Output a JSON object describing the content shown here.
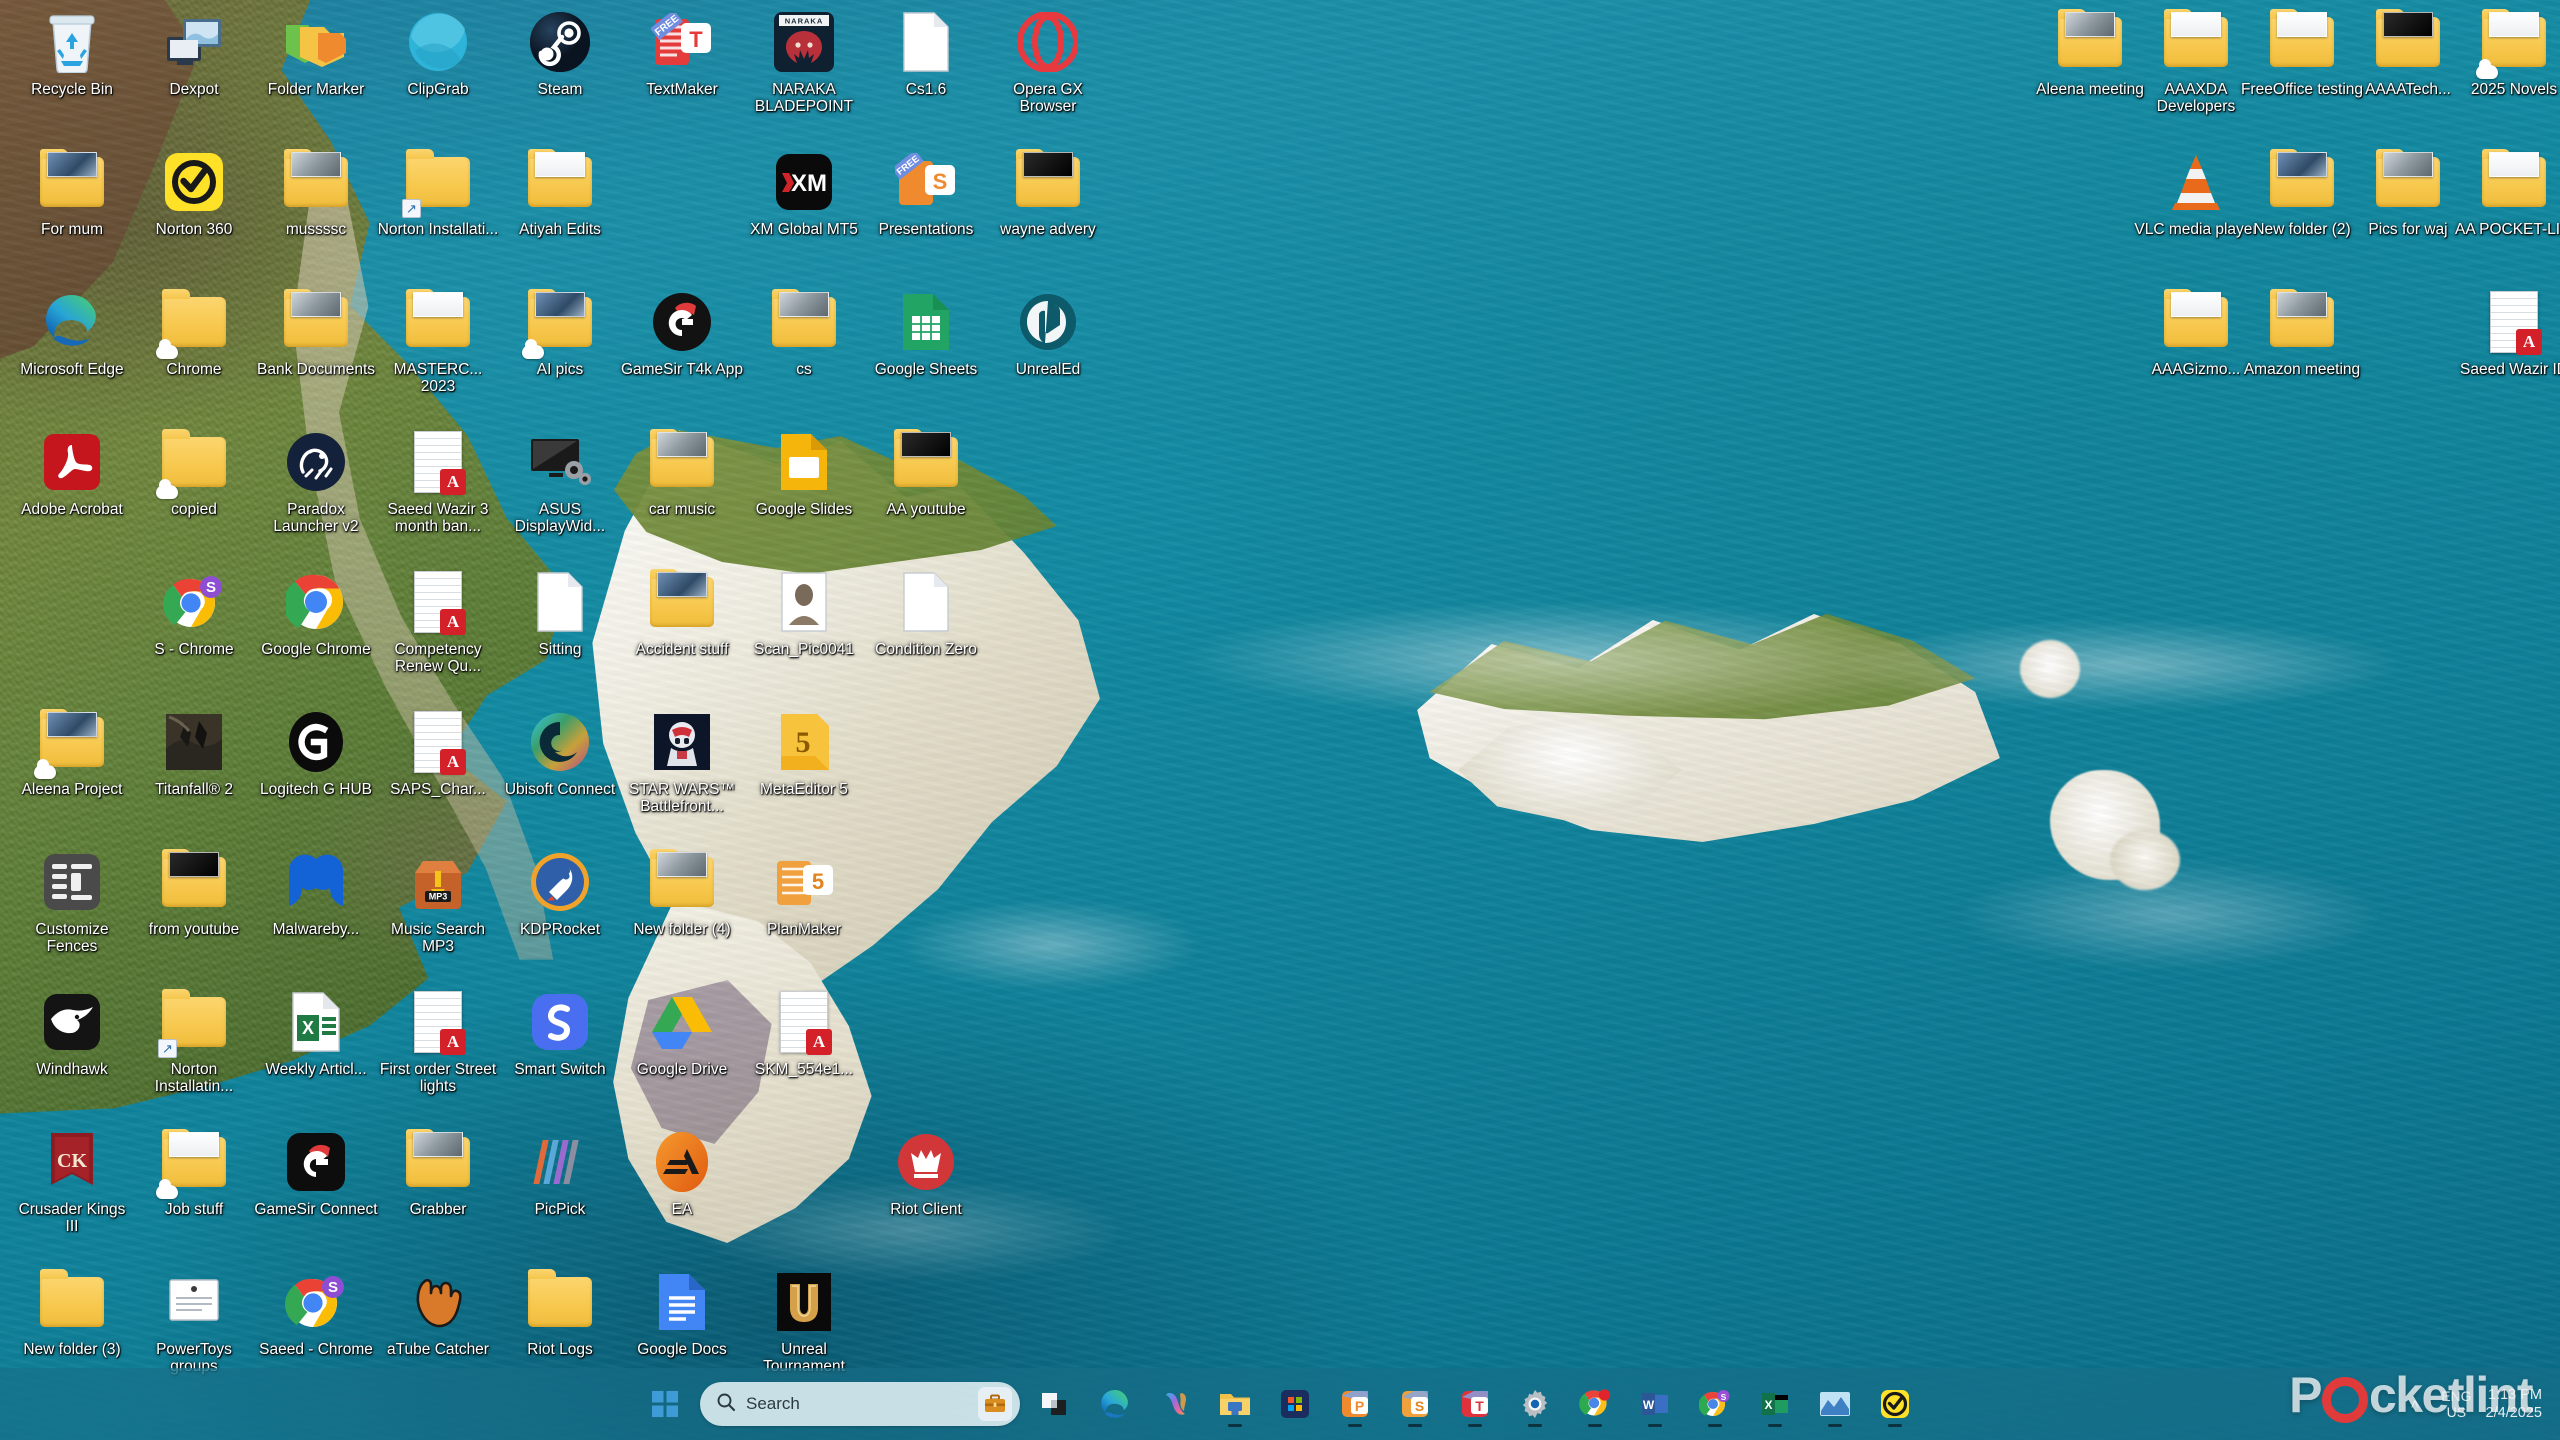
{
  "desktop": {
    "wallpaper_description": "Aerial photo of white chalk cliffs and turquoise sea",
    "left_icons": [
      {
        "label": "Recycle Bin",
        "icon": "recycle-bin-icon",
        "col": 0,
        "row": 0
      },
      {
        "label": "Dexpot",
        "icon": "dexpot-icon",
        "col": 1,
        "row": 0
      },
      {
        "label": "Folder Marker",
        "icon": "folder-marker-icon",
        "col": 2,
        "row": 0
      },
      {
        "label": "ClipGrab",
        "icon": "clipgrab-icon",
        "col": 3,
        "row": 0
      },
      {
        "label": "Steam",
        "icon": "steam-icon",
        "col": 4,
        "row": 0
      },
      {
        "label": "TextMaker",
        "icon": "textmaker-icon",
        "col": 5,
        "row": 0
      },
      {
        "label": "NARAKA BLADEPOINT",
        "icon": "naraka-bladepoint-icon",
        "col": 6,
        "row": 0
      },
      {
        "label": "Cs1.6",
        "icon": "document-icon",
        "col": 7,
        "row": 0
      },
      {
        "label": "Opera GX Browser",
        "icon": "opera-gx-icon",
        "col": 8,
        "row": 0
      },
      {
        "label": "For mum",
        "icon": "folder-icon",
        "col": 0,
        "row": 1
      },
      {
        "label": "Norton 360",
        "icon": "norton-360-icon",
        "col": 1,
        "row": 1
      },
      {
        "label": "mussssc",
        "icon": "folder-icon",
        "col": 2,
        "row": 1
      },
      {
        "label": "Norton Installati...",
        "icon": "folder-shortcut-icon",
        "col": 3,
        "row": 1
      },
      {
        "label": "Atiyah Edits",
        "icon": "folder-icon",
        "col": 4,
        "row": 1
      },
      {
        "label": "XM Global MT5",
        "icon": "xm-global-mt5-icon",
        "col": 6,
        "row": 1
      },
      {
        "label": "Presentations",
        "icon": "presentations-icon",
        "col": 7,
        "row": 1
      },
      {
        "label": "wayne advery",
        "icon": "folder-icon",
        "col": 8,
        "row": 1
      },
      {
        "label": "Microsoft Edge",
        "icon": "microsoft-edge-icon",
        "col": 0,
        "row": 2
      },
      {
        "label": "Chrome",
        "icon": "folder-icon",
        "col": 1,
        "row": 2
      },
      {
        "label": "Bank Documents",
        "icon": "folder-icon",
        "col": 2,
        "row": 2
      },
      {
        "label": "MASTERC... 2023",
        "icon": "folder-icon",
        "col": 3,
        "row": 2
      },
      {
        "label": "AI pics",
        "icon": "folder-icon",
        "col": 4,
        "row": 2
      },
      {
        "label": "GameSir T4k App",
        "icon": "gamesir-icon",
        "col": 5,
        "row": 2
      },
      {
        "label": "cs",
        "icon": "folder-icon",
        "col": 6,
        "row": 2
      },
      {
        "label": "Google Sheets",
        "icon": "google-sheets-icon",
        "col": 7,
        "row": 2
      },
      {
        "label": "UnrealEd",
        "icon": "unreal-engine-icon",
        "col": 8,
        "row": 2
      },
      {
        "label": "Adobe Acrobat",
        "icon": "adobe-acrobat-icon",
        "col": 0,
        "row": 3
      },
      {
        "label": "copied",
        "icon": "folder-icon",
        "col": 1,
        "row": 3
      },
      {
        "label": "Paradox Launcher v2",
        "icon": "paradox-launcher-icon",
        "col": 2,
        "row": 3
      },
      {
        "label": "Saeed Wazir 3 month ban...",
        "icon": "pdf-icon",
        "col": 3,
        "row": 3
      },
      {
        "label": "ASUS DisplayWid...",
        "icon": "asus-displaywidget-icon",
        "col": 4,
        "row": 3
      },
      {
        "label": "car music",
        "icon": "folder-icon",
        "col": 5,
        "row": 3
      },
      {
        "label": "Google Slides",
        "icon": "google-slides-icon",
        "col": 6,
        "row": 3
      },
      {
        "label": "AA youtube",
        "icon": "folder-icon",
        "col": 7,
        "row": 3
      },
      {
        "label": "S - Chrome",
        "icon": "chrome-profile-icon",
        "col": 1,
        "row": 4
      },
      {
        "label": "Google Chrome",
        "icon": "google-chrome-icon",
        "col": 2,
        "row": 4
      },
      {
        "label": "Competency Renew Qu...",
        "icon": "pdf-icon",
        "col": 3,
        "row": 4
      },
      {
        "label": "Sitting",
        "icon": "document-icon",
        "col": 4,
        "row": 4
      },
      {
        "label": "Accident stuff",
        "icon": "folder-icon",
        "col": 5,
        "row": 4
      },
      {
        "label": "Scan_Pic0041",
        "icon": "photo-icon",
        "col": 6,
        "row": 4
      },
      {
        "label": "Condition Zero",
        "icon": "document-icon",
        "col": 7,
        "row": 4
      },
      {
        "label": "Aleena Project",
        "icon": "folder-icon",
        "col": 0,
        "row": 5
      },
      {
        "label": "Titanfall® 2",
        "icon": "titanfall-icon",
        "col": 1,
        "row": 5
      },
      {
        "label": "Logitech G HUB",
        "icon": "logitech-ghub-icon",
        "col": 2,
        "row": 5
      },
      {
        "label": "SAPS_Char...",
        "icon": "pdf-icon",
        "col": 3,
        "row": 5
      },
      {
        "label": "Ubisoft Connect",
        "icon": "ubisoft-connect-icon",
        "col": 4,
        "row": 5
      },
      {
        "label": "STAR WARS™ Battlefront...",
        "icon": "star-wars-battlefront-icon",
        "col": 5,
        "row": 5
      },
      {
        "label": "MetaEditor 5",
        "icon": "metaeditor-icon",
        "col": 6,
        "row": 5
      },
      {
        "label": "Customize Fences",
        "icon": "customize-fences-icon",
        "col": 0,
        "row": 6
      },
      {
        "label": "from youtube",
        "icon": "folder-icon",
        "col": 1,
        "row": 6
      },
      {
        "label": "Malwareby...",
        "icon": "malwarebytes-icon",
        "col": 2,
        "row": 6
      },
      {
        "label": "Music Search MP3",
        "icon": "music-search-mp3-icon",
        "col": 3,
        "row": 6
      },
      {
        "label": "KDPRocket",
        "icon": "kdprocket-icon",
        "col": 4,
        "row": 6
      },
      {
        "label": "New folder (4)",
        "icon": "folder-icon",
        "col": 5,
        "row": 6
      },
      {
        "label": "PlanMaker",
        "icon": "planmaker-icon",
        "col": 6,
        "row": 6
      },
      {
        "label": "Windhawk",
        "icon": "windhawk-icon",
        "col": 0,
        "row": 7
      },
      {
        "label": "Norton Installatin...",
        "icon": "folder-shortcut-icon",
        "col": 1,
        "row": 7
      },
      {
        "label": "Weekly Articl...",
        "icon": "excel-icon",
        "col": 2,
        "row": 7
      },
      {
        "label": "First order Street lights",
        "icon": "pdf-icon",
        "col": 3,
        "row": 7
      },
      {
        "label": "Smart Switch",
        "icon": "smart-switch-icon",
        "col": 4,
        "row": 7
      },
      {
        "label": "Google Drive",
        "icon": "google-drive-icon",
        "col": 5,
        "row": 7
      },
      {
        "label": "SKM_554e1...",
        "icon": "pdf-icon",
        "col": 6,
        "row": 7
      },
      {
        "label": "Crusader Kings III",
        "icon": "crusader-kings-icon",
        "col": 0,
        "row": 8
      },
      {
        "label": "Job stuff",
        "icon": "folder-icon",
        "col": 1,
        "row": 8
      },
      {
        "label": "GameSir Connect",
        "icon": "gamesir-connect-icon",
        "col": 2,
        "row": 8
      },
      {
        "label": "Grabber",
        "icon": "folder-icon",
        "col": 3,
        "row": 8
      },
      {
        "label": "PicPick",
        "icon": "picpick-icon",
        "col": 4,
        "row": 8
      },
      {
        "label": "EA",
        "icon": "ea-icon",
        "col": 5,
        "row": 8
      },
      {
        "label": "Riot Client",
        "icon": "riot-client-icon",
        "col": 7,
        "row": 8
      },
      {
        "label": "New folder (3)",
        "icon": "folder-icon",
        "col": 0,
        "row": 9
      },
      {
        "label": "PowerToys groups",
        "icon": "powertoys-icon",
        "col": 1,
        "row": 9
      },
      {
        "label": "Saeed - Chrome",
        "icon": "chrome-profile-icon",
        "col": 2,
        "row": 9
      },
      {
        "label": "aTube Catcher",
        "icon": "atube-catcher-icon",
        "col": 3,
        "row": 9
      },
      {
        "label": "Riot Logs",
        "icon": "folder-icon",
        "col": 4,
        "row": 9
      },
      {
        "label": "Google Docs",
        "icon": "google-docs-icon",
        "col": 5,
        "row": 9
      },
      {
        "label": "Unreal Tournament",
        "icon": "unreal-tournament-icon",
        "col": 6,
        "row": 9
      }
    ],
    "right_icons": [
      {
        "label": "Aleena meeting",
        "icon": "folder-icon",
        "col": 0,
        "row": 0
      },
      {
        "label": "AAAXDA Developers",
        "icon": "folder-icon",
        "col": 1,
        "row": 0
      },
      {
        "label": "FreeOffice testing",
        "icon": "folder-icon",
        "col": 2,
        "row": 0
      },
      {
        "label": "AAAATech...",
        "icon": "folder-icon",
        "col": 3,
        "row": 0
      },
      {
        "label": "2025 Novels",
        "icon": "folder-icon",
        "col": 4,
        "row": 0
      },
      {
        "label": "VLC media player",
        "icon": "vlc-media-player-icon",
        "col": 1,
        "row": 1
      },
      {
        "label": "New folder (2)",
        "icon": "folder-icon",
        "col": 2,
        "row": 1
      },
      {
        "label": "Pics for waj",
        "icon": "folder-icon",
        "col": 3,
        "row": 1
      },
      {
        "label": "AA POCKET-LI...",
        "icon": "folder-icon",
        "col": 4,
        "row": 1
      },
      {
        "label": "AAAGizmo...",
        "icon": "folder-icon",
        "col": 1,
        "row": 2
      },
      {
        "label": "Amazon meeting",
        "icon": "folder-icon",
        "col": 2,
        "row": 2
      },
      {
        "label": "Saeed Wazir ID",
        "icon": "pdf-icon",
        "col": 4,
        "row": 2
      }
    ]
  },
  "taskbar": {
    "start_label": "Start",
    "search": {
      "placeholder": "Search",
      "icon": "search-icon",
      "widget_icon": "briefcase-icon"
    },
    "pinned": [
      {
        "name": "task-view",
        "label": "Task View",
        "running": false
      },
      {
        "name": "microsoft-edge",
        "label": "Microsoft Edge",
        "running": false
      },
      {
        "name": "copilot",
        "label": "Copilot",
        "running": false
      },
      {
        "name": "file-explorer",
        "label": "File Explorer",
        "running": true
      },
      {
        "name": "microsoft-store",
        "label": "Microsoft Store",
        "running": false
      },
      {
        "name": "presentations",
        "label": "Presentations",
        "running": true
      },
      {
        "name": "planmaker",
        "label": "PlanMaker",
        "running": true
      },
      {
        "name": "textmaker",
        "label": "TextMaker",
        "running": true
      },
      {
        "name": "settings",
        "label": "Settings",
        "running": true
      },
      {
        "name": "google-chrome",
        "label": "Google Chrome",
        "running": true
      },
      {
        "name": "microsoft-word",
        "label": "Microsoft Word",
        "running": true
      },
      {
        "name": "chrome-profile-s",
        "label": "Chrome - S",
        "running": true
      },
      {
        "name": "microsoft-excel",
        "label": "Microsoft Excel",
        "running": true
      },
      {
        "name": "charts-app",
        "label": "Charts",
        "running": true
      },
      {
        "name": "norton-360",
        "label": "Norton 360",
        "running": true
      }
    ],
    "tray": {
      "chevron": "˄",
      "language": "ENG",
      "language_sub": "US",
      "time": "1:13 PM",
      "date": "2/4/2025"
    }
  },
  "watermark": {
    "text_before": "P",
    "text_mid": "cketlint"
  }
}
